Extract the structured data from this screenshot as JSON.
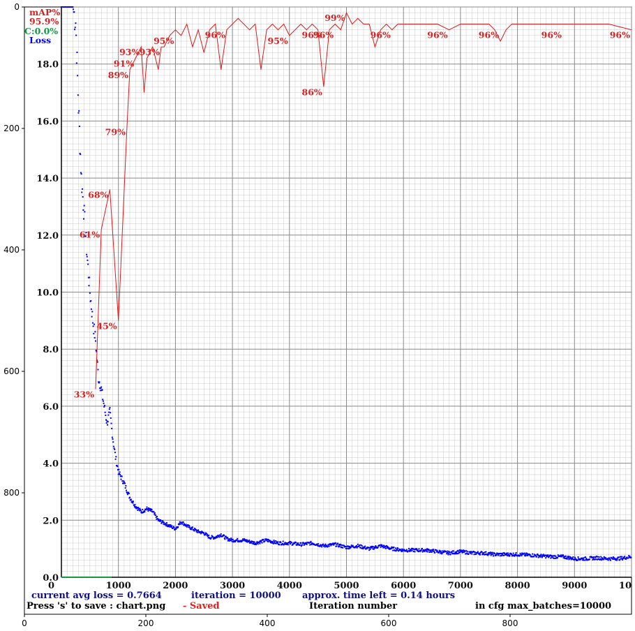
{
  "frame": {
    "x_ticks": [
      "0",
      "200",
      "400",
      "600",
      "800"
    ],
    "y_ticks": [
      "0",
      "200",
      "400",
      "600",
      "800"
    ]
  },
  "legend": {
    "map_label": "mAP%",
    "map_value": "95.9%",
    "c_value": "C:0.0%",
    "loss_label": "Loss"
  },
  "status": {
    "loss_line": "current avg loss = 0.7664",
    "iteration_line": "iteration = 10000",
    "time_line": "approx. time left = 0.14 hours",
    "save_hint": "Press 's' to save : chart.png",
    "saved": "- Saved",
    "xlabel": "Iteration number",
    "max_batches": "in cfg max_batches=10000"
  },
  "colors": {
    "loss": "#0000ff",
    "map": "#e01818",
    "c": "#119944",
    "text_blue": "#101080",
    "grid": "#c8c8c8",
    "grid_major": "#888888"
  },
  "chart_data": {
    "type": "line",
    "xlabel": "Iteration number",
    "ylabel": "",
    "xlim": [
      0,
      10000
    ],
    "ylim": [
      0,
      20
    ],
    "x_tick_labels": [
      "0",
      "1000",
      "2000",
      "3000",
      "4000",
      "5000",
      "6000",
      "7000",
      "8000",
      "9000",
      "10"
    ],
    "y_tick_labels": [
      "0.0",
      "2.0",
      "4.0",
      "6.0",
      "8.0",
      "10.0",
      "12.0",
      "14.0",
      "16.0",
      "18.0"
    ],
    "series": [
      {
        "name": "Loss",
        "x": [
          0,
          100,
          150,
          200,
          250,
          300,
          350,
          400,
          450,
          500,
          550,
          600,
          650,
          700,
          750,
          800,
          850,
          900,
          950,
          1000,
          1100,
          1200,
          1300,
          1400,
          1500,
          1600,
          1700,
          1800,
          1900,
          2000,
          2100,
          2200,
          2300,
          2400,
          2500,
          2600,
          2700,
          2800,
          2900,
          3000,
          3200,
          3400,
          3600,
          3800,
          4000,
          4200,
          4400,
          4600,
          4800,
          5000,
          5200,
          5400,
          5600,
          5800,
          6000,
          6200,
          6400,
          6600,
          6800,
          7000,
          7200,
          7400,
          7600,
          7800,
          8000,
          8200,
          8400,
          8600,
          8800,
          9000,
          9200,
          9400,
          9600,
          9800,
          10000
        ],
        "y": [
          20,
          20,
          20,
          20,
          19.5,
          16.5,
          14,
          12.7,
          11.3,
          10.0,
          9.0,
          8.3,
          7.0,
          6.6,
          6.0,
          5.4,
          5.8,
          4.9,
          4.2,
          3.7,
          3.3,
          2.8,
          2.5,
          2.3,
          2.4,
          2.3,
          2.0,
          1.9,
          1.8,
          1.7,
          1.95,
          1.8,
          1.7,
          1.6,
          1.55,
          1.4,
          1.4,
          1.5,
          1.35,
          1.3,
          1.3,
          1.2,
          1.3,
          1.2,
          1.2,
          1.15,
          1.2,
          1.1,
          1.15,
          1.05,
          1.1,
          1.0,
          1.1,
          1.0,
          0.95,
          0.95,
          0.95,
          0.9,
          0.85,
          0.9,
          0.85,
          0.85,
          0.8,
          0.8,
          0.8,
          0.78,
          0.75,
          0.72,
          0.72,
          0.65,
          0.65,
          0.68,
          0.65,
          0.66,
          0.72
        ]
      },
      {
        "name": "mAP%",
        "x": [
          600,
          700,
          850,
          1000,
          1150,
          1200,
          1300,
          1400,
          1450,
          1500,
          1600,
          1700,
          1750,
          1800,
          1900,
          2000,
          2100,
          2200,
          2300,
          2400,
          2500,
          2600,
          2700,
          2800,
          2900,
          3000,
          3100,
          3200,
          3300,
          3400,
          3500,
          3600,
          3700,
          3800,
          3900,
          4000,
          4100,
          4200,
          4300,
          4400,
          4500,
          4600,
          4700,
          4800,
          4900,
          5000,
          5100,
          5200,
          5300,
          5400,
          5500,
          5600,
          5700,
          5800,
          5900,
          6000,
          6200,
          6400,
          6600,
          6800,
          7000,
          7200,
          7400,
          7500,
          7600,
          7700,
          7800,
          7900,
          8000,
          8400,
          8800,
          9200,
          9600,
          10000
        ],
        "y": [
          33,
          61,
          68,
          45,
          79,
          89,
          91,
          93,
          85,
          91,
          93,
          89,
          93,
          93,
          95,
          96,
          95,
          97,
          93,
          96,
          92,
          96,
          97,
          89,
          96,
          97,
          98,
          97,
          96,
          97,
          89,
          96,
          97,
          96,
          97,
          95,
          96,
          97,
          96,
          97,
          96,
          86,
          96,
          97,
          96,
          99,
          97,
          98,
          97,
          97,
          93,
          96,
          97,
          96,
          97,
          97,
          97,
          97,
          97,
          96,
          97,
          97,
          97,
          97,
          96,
          94,
          96,
          97,
          97,
          97,
          97,
          97,
          97,
          96
        ]
      }
    ],
    "annotations": [
      {
        "x": 600,
        "y": 33,
        "text": "33%"
      },
      {
        "x": 700,
        "y": 61,
        "text": "61%"
      },
      {
        "x": 850,
        "y": 68,
        "text": "68%"
      },
      {
        "x": 1000,
        "y": 45,
        "text": "45%"
      },
      {
        "x": 1150,
        "y": 79,
        "text": "79%"
      },
      {
        "x": 1200,
        "y": 89,
        "text": "89%"
      },
      {
        "x": 1300,
        "y": 91,
        "text": "91%"
      },
      {
        "x": 1400,
        "y": 93,
        "text": "93%"
      },
      {
        "x": 1750,
        "y": 93,
        "text": "93%"
      },
      {
        "x": 2000,
        "y": 95,
        "text": "95%"
      },
      {
        "x": 2900,
        "y": 96,
        "text": "96%"
      },
      {
        "x": 4000,
        "y": 95,
        "text": "95%"
      },
      {
        "x": 4600,
        "y": 86,
        "text": "86%"
      },
      {
        "x": 4600,
        "y": 96,
        "text": "96%"
      },
      {
        "x": 4800,
        "y": 96,
        "text": "96%"
      },
      {
        "x": 5000,
        "y": 99,
        "text": "99%"
      },
      {
        "x": 5800,
        "y": 96,
        "text": "96%"
      },
      {
        "x": 6800,
        "y": 96,
        "text": "96%"
      },
      {
        "x": 7700,
        "y": 96,
        "text": "96%"
      },
      {
        "x": 8800,
        "y": 96,
        "text": "96%"
      },
      {
        "x": 10000,
        "y": 96,
        "text": "96%"
      }
    ],
    "grid": true
  }
}
